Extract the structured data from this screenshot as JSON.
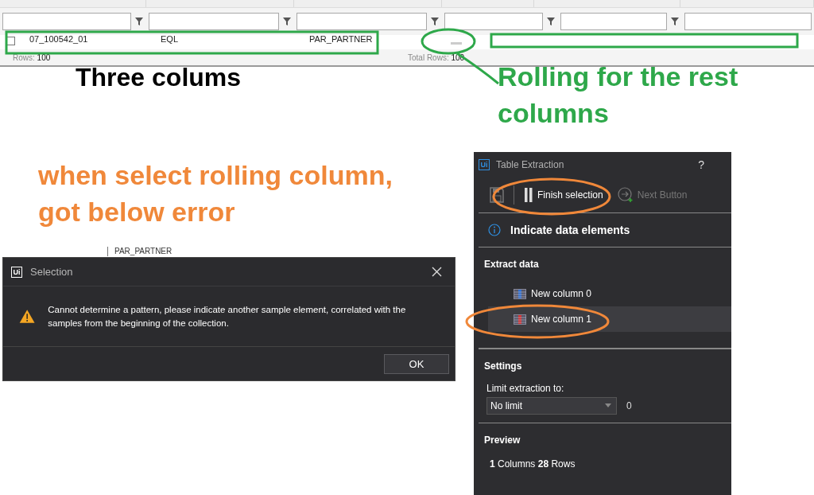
{
  "grid": {
    "filters": [
      {
        "has_filter": true
      },
      {
        "has_filter": true
      },
      {
        "has_filter": true
      },
      {
        "has_filter": true
      },
      {
        "has_filter": true
      },
      {
        "has_filter": false
      }
    ],
    "row": {
      "cells": [
        "07_100542_01",
        "EQL",
        "PAR_PARTNER"
      ],
      "checked": false
    },
    "footer": {
      "rows_label": "Rows:",
      "rows_value": "100",
      "total_label": "Total Rows:",
      "total_value": "100"
    }
  },
  "annotations": [
    {
      "text": "Three colums",
      "color": "#000000"
    },
    {
      "text": "Rolling for the rest columns",
      "color": "#2ea84a"
    },
    {
      "text": "when select rolling column, got below error",
      "color": "#f0883a"
    }
  ],
  "background_row": {
    "cell": "PAR_PARTNER"
  },
  "dialog": {
    "logo": "Ui",
    "title": "Selection",
    "message": "Cannot determine a pattern, please indicate another sample element, correlated with the samples from the beginning of the collection.",
    "buttons": [
      "OK"
    ]
  },
  "panel": {
    "title": "Table Extraction",
    "help": "?",
    "logo": "Ui",
    "toolbar": [
      {
        "kind": "save"
      },
      {
        "kind": "pause",
        "label": "Finish selection",
        "disabled": false
      },
      {
        "kind": "next",
        "label": "Next Button",
        "disabled": true
      }
    ],
    "heading": "Indicate data elements",
    "extract_title": "Extract data",
    "columns": [
      {
        "label": "New column 0",
        "selected": false,
        "color": "#2f6fd0"
      },
      {
        "label": "New column 1",
        "selected": true,
        "color": "#d03030"
      }
    ],
    "settings_title": "Settings",
    "limit_label": "Limit extraction to:",
    "limit_value": "No limit",
    "limit_count": "0",
    "preview_title": "Preview",
    "preview_text": "**1** Columns  **28** Rows"
  }
}
